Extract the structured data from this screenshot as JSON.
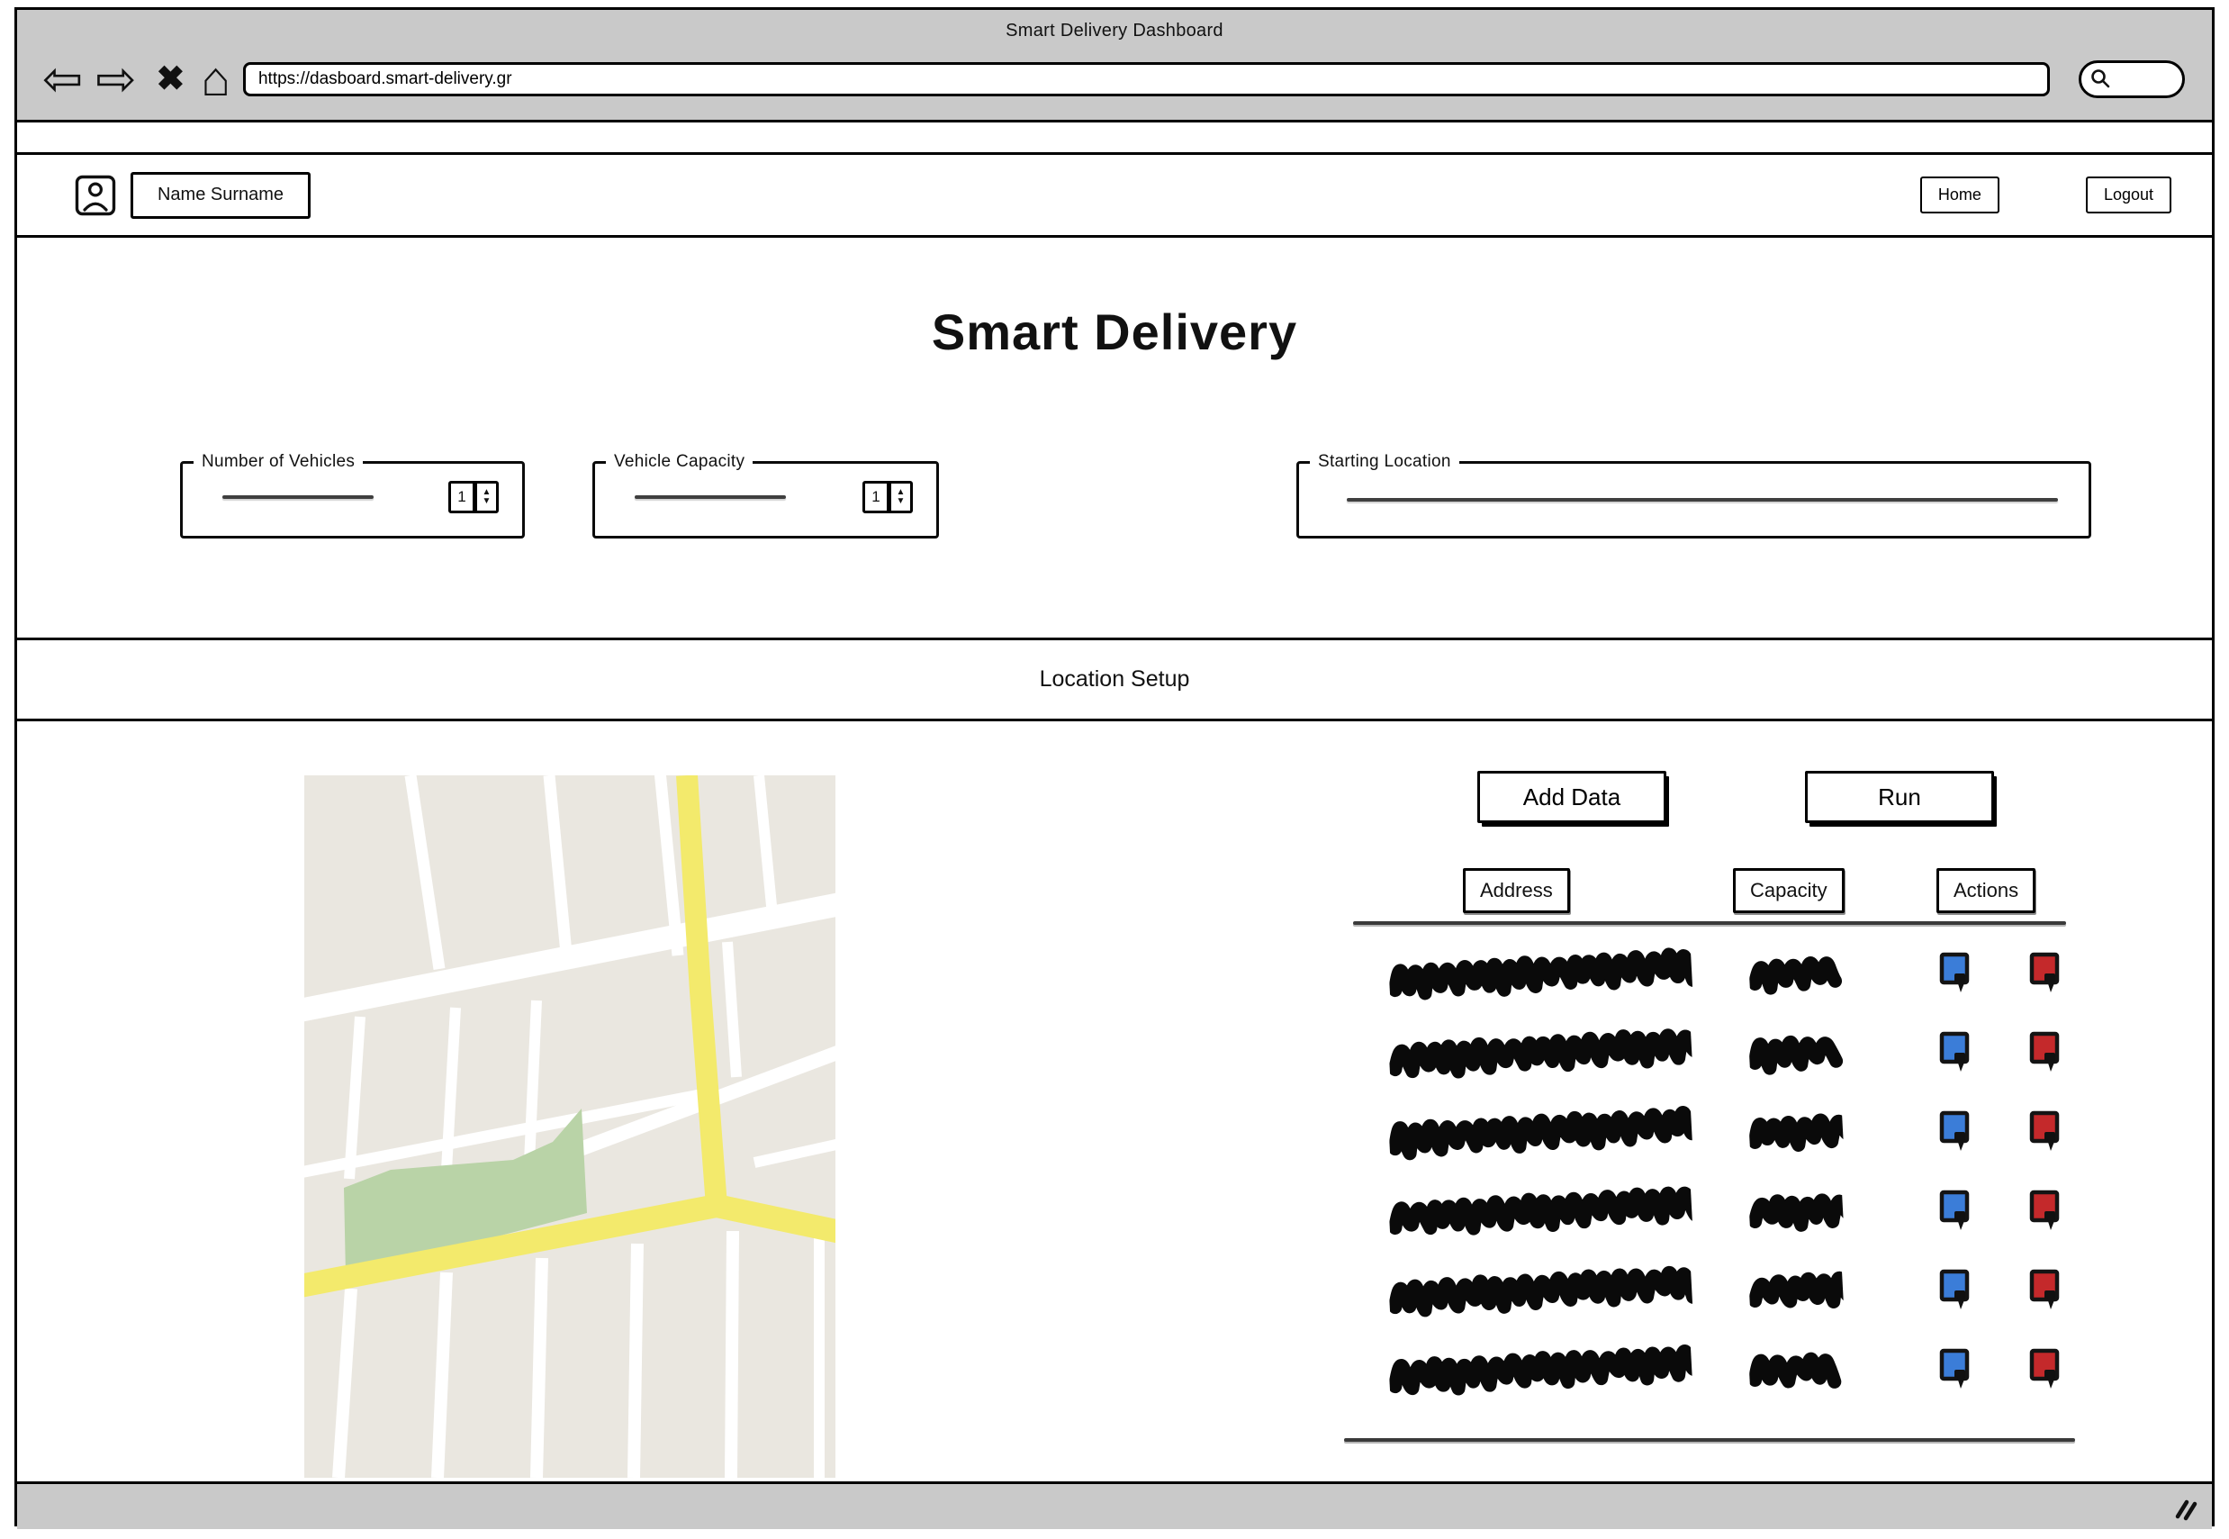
{
  "window": {
    "title": "Smart Delivery Dashboard"
  },
  "browser": {
    "url": "https://dasboard.smart-delivery.gr",
    "back_icon": "⇦",
    "forward_icon": "⇨",
    "stop_icon": "✖",
    "home_icon": "⌂"
  },
  "header": {
    "user_name": "Name Surname",
    "home_label": "Home",
    "logout_label": "Logout"
  },
  "main": {
    "title": "Smart Delivery",
    "vehicles": {
      "label": "Number of Vehicles",
      "value": "1"
    },
    "capacity": {
      "label": "Vehicle Capacity",
      "value": "1"
    },
    "starting_location": {
      "label": "Starting Location",
      "value": ""
    }
  },
  "section": {
    "title": "Location Setup"
  },
  "table": {
    "add_button": "Add Data",
    "run_button": "Run",
    "columns": [
      "Address",
      "Capacity",
      "Actions"
    ],
    "rows": [
      {
        "address_scribble": true,
        "capacity_scribble": true
      },
      {
        "address_scribble": true,
        "capacity_scribble": true
      },
      {
        "address_scribble": true,
        "capacity_scribble": true
      },
      {
        "address_scribble": true,
        "capacity_scribble": true
      },
      {
        "address_scribble": true,
        "capacity_scribble": true
      },
      {
        "address_scribble": true,
        "capacity_scribble": true
      }
    ]
  },
  "spinner": {
    "up_icon": "▲",
    "down_icon": "▼"
  },
  "colors": {
    "chrome_gray": "#c9c9c9",
    "action_blue": "#3b7dd8",
    "action_red": "#c4292b",
    "map_block": "#eae7e0",
    "map_green": "#b9d3a7",
    "map_road_yellow": "#f3ea6c",
    "street_white": "#ffffff"
  }
}
